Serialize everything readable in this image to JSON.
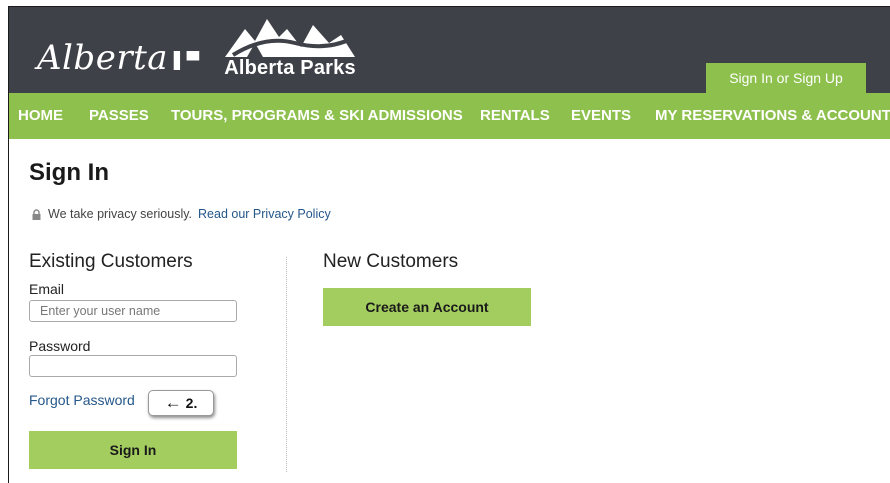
{
  "header": {
    "alberta_logo_text": "Alberta",
    "parks_logo_text": "Alberta Parks",
    "signin_tab": "Sign In or Sign Up"
  },
  "nav": {
    "items": [
      {
        "label": "HOME"
      },
      {
        "label": "PASSES"
      },
      {
        "label": "TOURS, PROGRAMS & SKI ADMISSIONS"
      },
      {
        "label": "RENTALS"
      },
      {
        "label": "EVENTS"
      },
      {
        "label": "MY RESERVATIONS & ACCOUNT"
      }
    ]
  },
  "page": {
    "title": "Sign In",
    "privacy_text": "We take privacy seriously.",
    "privacy_link": "Read our Privacy Policy"
  },
  "existing": {
    "title": "Existing Customers",
    "email_label": "Email",
    "email_placeholder": "Enter your user name",
    "email_value": "",
    "password_label": "Password",
    "password_value": "",
    "forgot_label": "Forgot Password",
    "signin_button": "Sign In"
  },
  "annotation": {
    "arrow": "←",
    "label": "2."
  },
  "new_customers": {
    "title": "New Customers",
    "create_button": "Create an Account"
  },
  "colors": {
    "header_bg": "#3f4148",
    "nav_green": "#8dc04d",
    "button_green": "#a3cd5e",
    "link_blue": "#24578a"
  },
  "icons": {
    "privacy": "lock-icon",
    "logo": "mountain-logo-icon"
  }
}
